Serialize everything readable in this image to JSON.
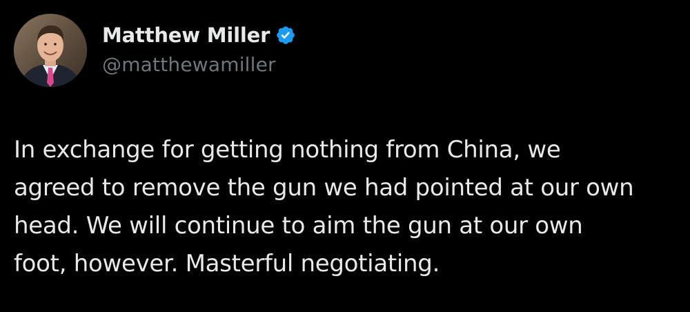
{
  "author": {
    "display_name": "Matthew Miller",
    "handle": "@matthewamiller",
    "verified": true,
    "avatar_icon": "profile-photo"
  },
  "tweet": {
    "text": "In exchange for getting nothing from China, we\nagreed to remove the gun we had pointed at our own\nhead. We will continue to aim the gun at our own\nfoot, however. Masterful negotiating."
  },
  "colors": {
    "background": "#000000",
    "text_primary": "#e7e9ea",
    "text_secondary": "#71767b",
    "verified_blue": "#1d9bf0"
  }
}
